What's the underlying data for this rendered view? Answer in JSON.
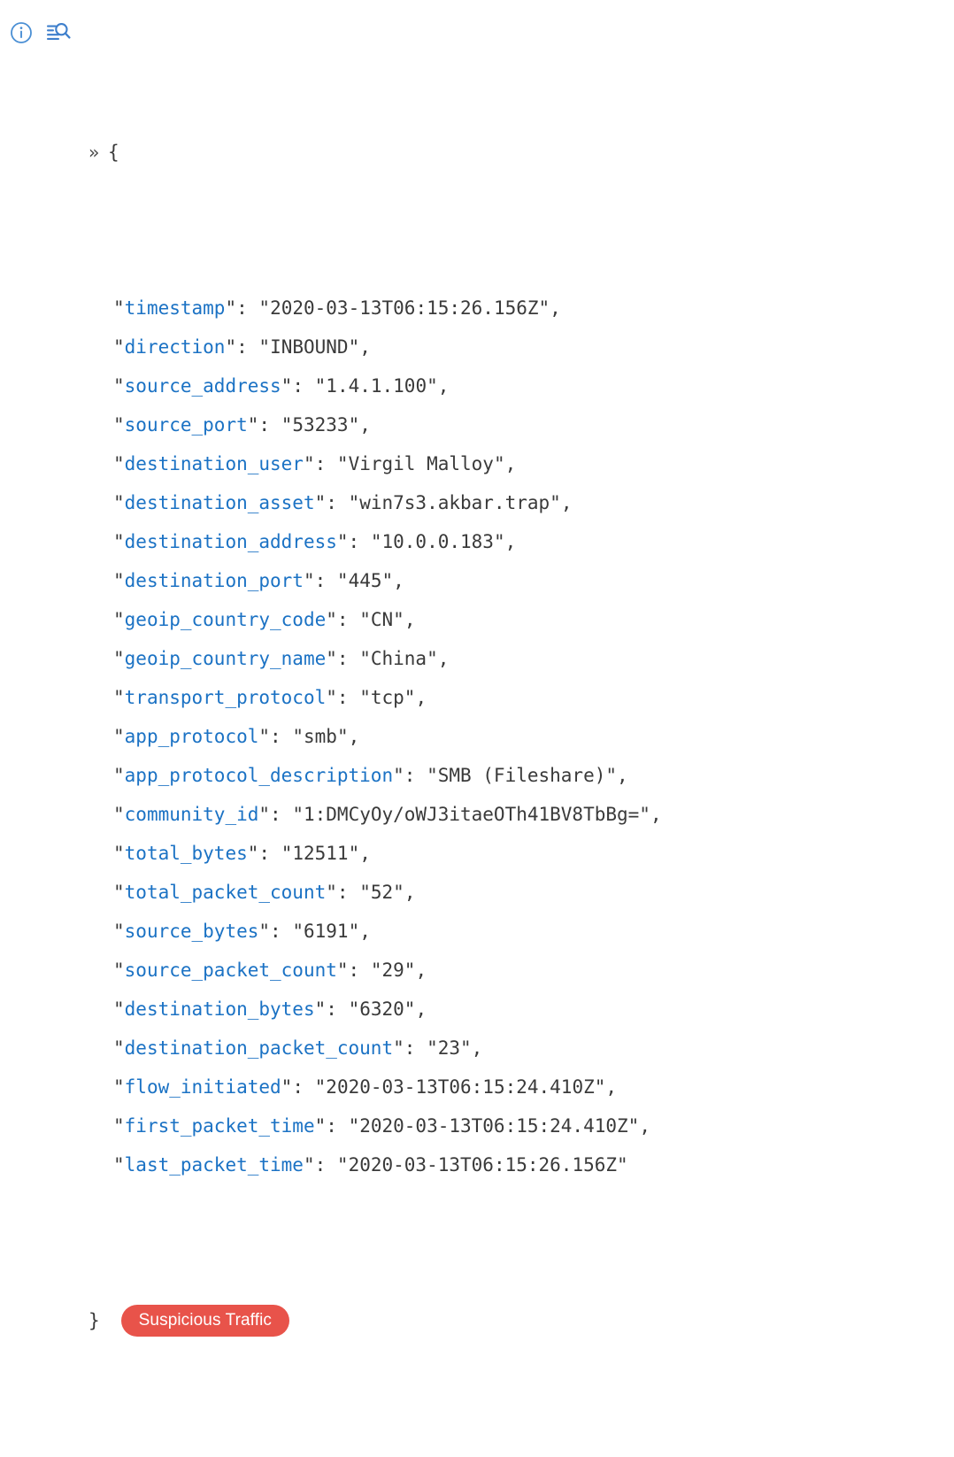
{
  "toolbar": {
    "icons": [
      {
        "name": "info-circle-icon",
        "title": "Details"
      },
      {
        "name": "log-search-icon",
        "title": "Inspect logs"
      }
    ],
    "expand_chevron": "»"
  },
  "json_view": {
    "open_brace": "{",
    "close_brace": "}",
    "colon": ":",
    "comma": ",",
    "quote": "\"",
    "key_color": "#1b72c4",
    "value_color": "#3a3a3a",
    "entries": [
      {
        "key": "timestamp",
        "value": "2020-03-13T06:15:26.156Z",
        "comma": ","
      },
      {
        "key": "direction",
        "value": "INBOUND",
        "comma": ","
      },
      {
        "key": "source_address",
        "value": "1.4.1.100",
        "comma": ","
      },
      {
        "key": "source_port",
        "value": "53233",
        "comma": ","
      },
      {
        "key": "destination_user",
        "value": "Virgil Malloy",
        "comma": ","
      },
      {
        "key": "destination_asset",
        "value": "win7s3.akbar.trap",
        "comma": ","
      },
      {
        "key": "destination_address",
        "value": "10.0.0.183",
        "comma": ","
      },
      {
        "key": "destination_port",
        "value": "445",
        "comma": ","
      },
      {
        "key": "geoip_country_code",
        "value": "CN",
        "comma": ","
      },
      {
        "key": "geoip_country_name",
        "value": "China",
        "comma": ","
      },
      {
        "key": "transport_protocol",
        "value": "tcp",
        "comma": ","
      },
      {
        "key": "app_protocol",
        "value": "smb",
        "comma": ","
      },
      {
        "key": "app_protocol_description",
        "value": "SMB (Fileshare)",
        "comma": ","
      },
      {
        "key": "community_id",
        "value": "1:DMCyOy/oWJ3itaeOTh41BV8TbBg=",
        "comma": ","
      },
      {
        "key": "total_bytes",
        "value": "12511",
        "comma": ","
      },
      {
        "key": "total_packet_count",
        "value": "52",
        "comma": ","
      },
      {
        "key": "source_bytes",
        "value": "6191",
        "comma": ","
      },
      {
        "key": "source_packet_count",
        "value": "29",
        "comma": ","
      },
      {
        "key": "destination_bytes",
        "value": "6320",
        "comma": ","
      },
      {
        "key": "destination_packet_count",
        "value": "23",
        "comma": ","
      },
      {
        "key": "flow_initiated",
        "value": "2020-03-13T06:15:24.410Z",
        "comma": ","
      },
      {
        "key": "first_packet_time",
        "value": "2020-03-13T06:15:24.410Z",
        "comma": ","
      },
      {
        "key": "last_packet_time",
        "value": "2020-03-13T06:15:26.156Z",
        "comma": ""
      }
    ]
  },
  "badge": {
    "label": "Suspicious Traffic",
    "background_color": "#e8534a",
    "text_color": "#ffffff"
  }
}
